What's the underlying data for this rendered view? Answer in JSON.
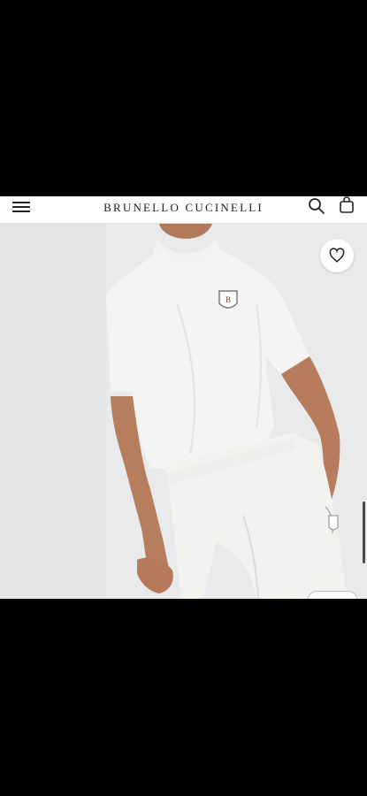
{
  "header": {
    "brand": "BRUNELLO CUCINELLI",
    "menu_icon": "hamburger-menu-icon",
    "search_icon": "search-icon",
    "bag_icon": "shopping-bag-icon"
  },
  "product": {
    "image_description": "product-photo",
    "wishlist_icon": "heart-icon"
  },
  "colors": {
    "background": "#000000",
    "header_bg": "#ffffff",
    "photo_bg": "#e9ebec",
    "brand_text": "#1e1e1e"
  }
}
